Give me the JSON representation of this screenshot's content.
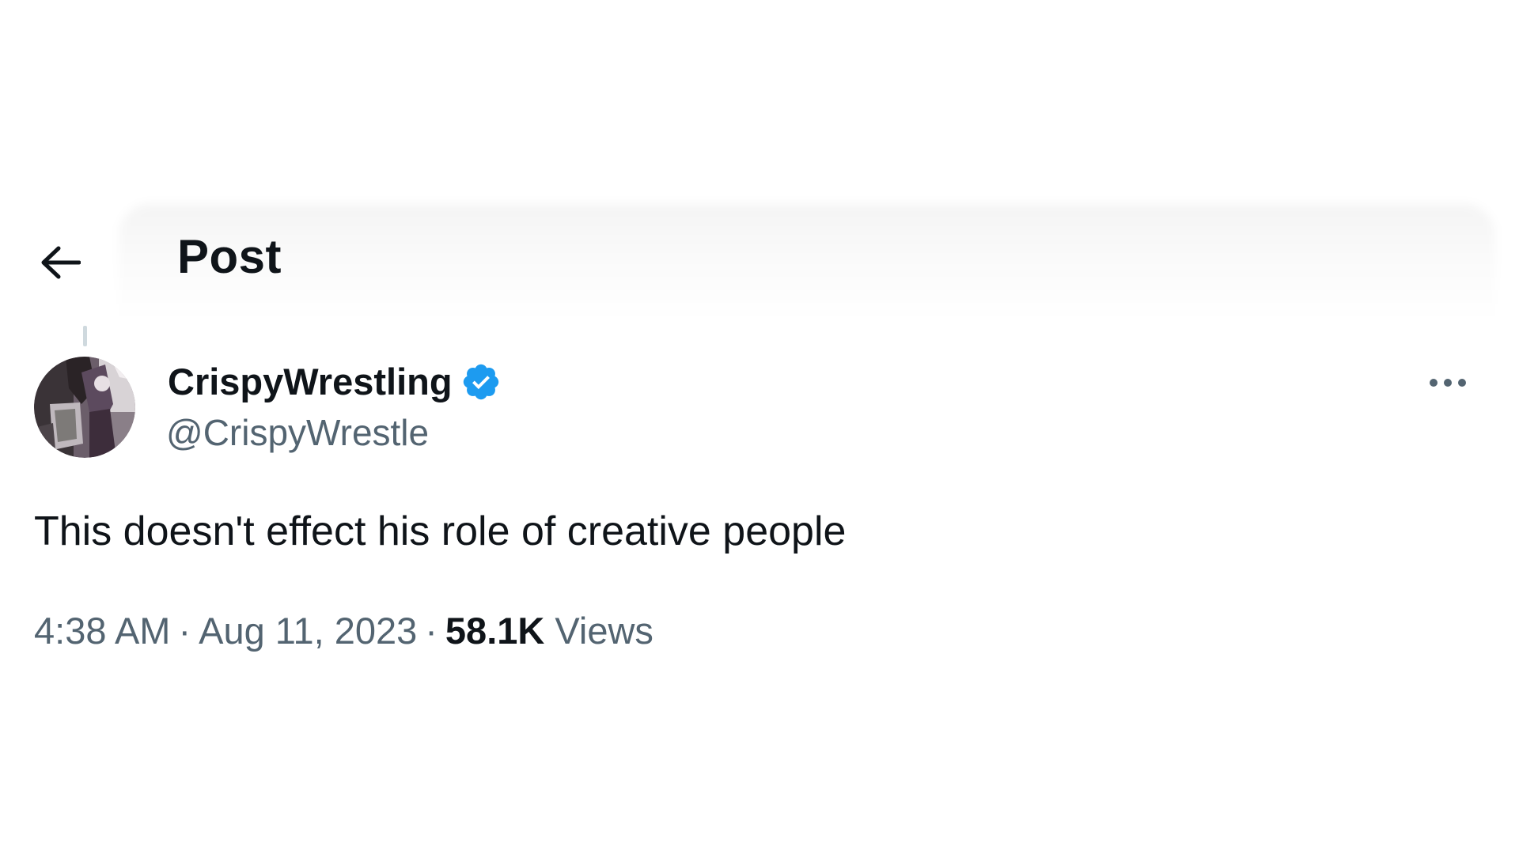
{
  "header": {
    "title": "Post",
    "back_icon": "arrow-left-icon"
  },
  "post": {
    "author": {
      "display_name": "CrispyWrestling",
      "handle": "@CrispyWrestle",
      "verified": true,
      "verified_icon": "verified-badge-icon",
      "avatar": "profile-photo"
    },
    "more_icon": "more-horizontal-icon",
    "text": "This doesn't effect his role of creative people",
    "time": "4:38 AM",
    "separator": "·",
    "date": "Aug 11, 2023",
    "views_count": "58.1K",
    "views_label": "Views"
  },
  "colors": {
    "text_primary": "#0f1419",
    "text_secondary": "#536471",
    "verified_blue": "#1d9bf0",
    "thread_line": "#cfd9de",
    "background": "#ffffff"
  }
}
